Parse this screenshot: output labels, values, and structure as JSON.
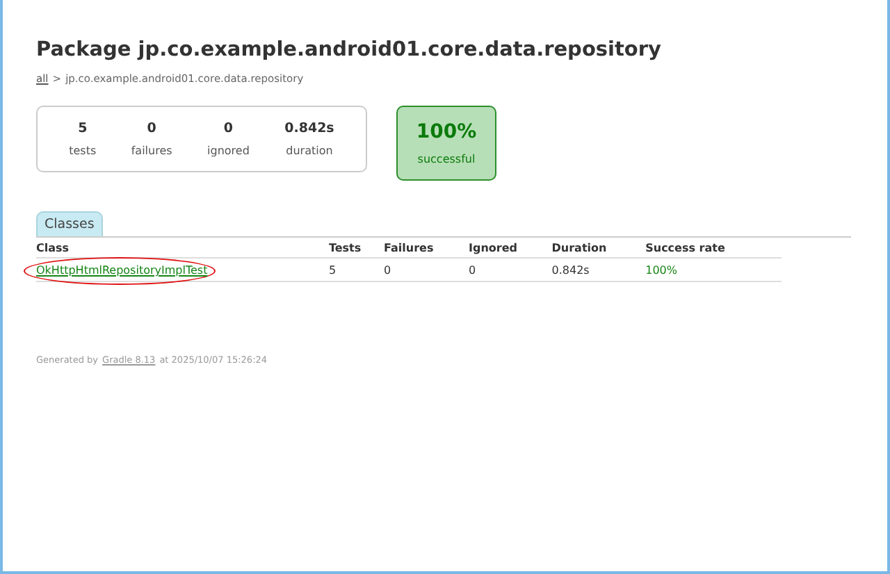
{
  "title": "Package jp.co.example.android01.core.data.repository",
  "breadcrumb": {
    "link": "all",
    "separator": ">",
    "current": "jp.co.example.android01.core.data.repository"
  },
  "summary": [
    {
      "value": "5",
      "label": "tests"
    },
    {
      "value": "0",
      "label": "failures"
    },
    {
      "value": "0",
      "label": "ignored"
    },
    {
      "value": "0.842s",
      "label": "duration"
    }
  ],
  "success": {
    "value": "100%",
    "label": "successful",
    "passed": true
  },
  "tabs": [
    {
      "label": "Classes",
      "selected": true
    }
  ],
  "table": {
    "columns": [
      "Class",
      "Tests",
      "Failures",
      "Ignored",
      "Duration",
      "Success rate"
    ],
    "rows": [
      {
        "class": "OkHttpHtmlRepositoryImplTest",
        "tests": "5",
        "failures": "0",
        "ignored": "0",
        "duration": "0.842s",
        "success_rate": "100%",
        "passed": true,
        "circled": true
      }
    ]
  },
  "footer": {
    "prefix": "Generated by",
    "link": "Gradle 8.13",
    "suffix": "at 2025/10/07 15:26:24"
  }
}
